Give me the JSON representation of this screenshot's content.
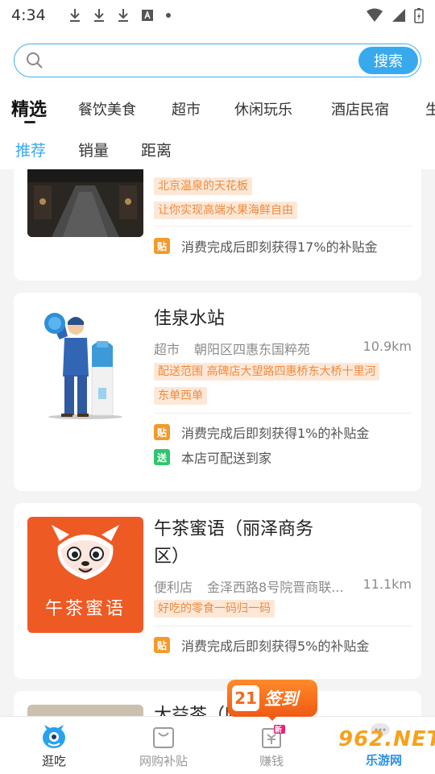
{
  "status_bar": {
    "time": "4:34"
  },
  "search": {
    "placeholder": "",
    "button_label": "搜索"
  },
  "categories": [
    "精选",
    "餐饮美食",
    "超市",
    "休闲玩乐",
    "酒店民宿",
    "生"
  ],
  "sort_tabs": [
    "推荐",
    "销量",
    "距离"
  ],
  "cards": [
    {
      "tags": [
        "北京温泉的天花板",
        "让你实现高端水果海鲜自由"
      ],
      "perks": [
        {
          "badge": "贴",
          "text": "消费完成后即刻获得17%的补贴金"
        }
      ]
    },
    {
      "title": "佳泉水站",
      "category": "超市",
      "address": "朝阳区四惠东国粹苑",
      "distance": "10.9km",
      "tags": [
        "配送范围 高碑店大望路四惠桥东大桥十里河",
        "东单西单"
      ],
      "perks": [
        {
          "badge": "贴",
          "text": "消费完成后即刻获得1%的补贴金"
        },
        {
          "badge": "送",
          "text": "本店可配送到家"
        }
      ]
    },
    {
      "title_line1": "午茶蜜语（丽泽商务",
      "title_line2": "区）",
      "category": "便利店",
      "address": "金泽西路8号院晋商联...",
      "distance": "11.1km",
      "logo_text": "午茶蜜语",
      "tags": [
        "好吃的零食一码归一码"
      ],
      "perks": [
        {
          "badge": "贴",
          "text": "消费完成后即刻获得5%的补贴金"
        }
      ]
    },
    {
      "title_partial": "大益茶（四"
    }
  ],
  "signin": {
    "number": "21",
    "label": "签到"
  },
  "bottom_nav": [
    {
      "label": "逛吃",
      "active": true
    },
    {
      "label": "网购补贴",
      "active": false
    },
    {
      "label": "赚钱",
      "active": false,
      "badge": "新"
    }
  ],
  "watermark": {
    "main": "962.NET",
    "sub": "乐游网"
  },
  "colors": {
    "accent": "#39a9ee",
    "tag_text": "#ef8a3c",
    "tag_bg": "#fde8d8",
    "subsidy": "#f39a2b",
    "deliver": "#2fc46f",
    "signin": "#f05a14"
  }
}
